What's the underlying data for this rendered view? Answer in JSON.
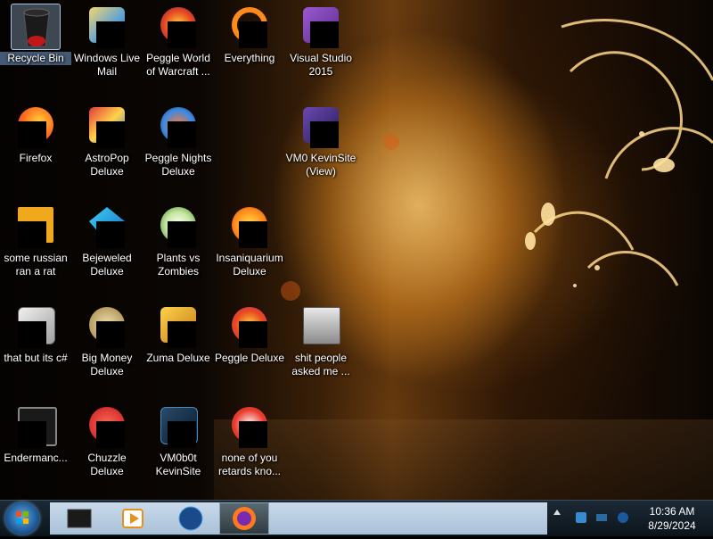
{
  "desktop_icons": [
    {
      "label": "Recycle Bin",
      "icon": "recycle-bin-icon"
    },
    {
      "label": "Windows Live Mail",
      "icon": "windows-live-mail-icon"
    },
    {
      "label": "Peggle World of Warcraft ...",
      "icon": "peggle-wow-icon"
    },
    {
      "label": "Everything",
      "icon": "everything-search-icon"
    },
    {
      "label": "Visual Studio 2015",
      "icon": "visual-studio-icon"
    },
    {
      "label": "Firefox",
      "icon": "firefox-icon"
    },
    {
      "label": "AstroPop Deluxe",
      "icon": "astropop-icon"
    },
    {
      "label": "Peggle Nights Deluxe",
      "icon": "peggle-nights-icon"
    },
    {
      "label": "VM0 KevinSite (View)",
      "icon": "visual-studio-file-icon"
    },
    {
      "label": "some russian ran a rat",
      "icon": "java-file-icon"
    },
    {
      "label": "Bejeweled Deluxe",
      "icon": "bejeweled-icon"
    },
    {
      "label": "Plants vs Zombies",
      "icon": "plants-vs-zombies-icon"
    },
    {
      "label": "Insaniquarium Deluxe",
      "icon": "insaniquarium-icon"
    },
    {
      "label": "that but its c#",
      "icon": "folder-stack-icon"
    },
    {
      "label": "Big Money Deluxe",
      "icon": "big-money-icon"
    },
    {
      "label": "Zuma Deluxe",
      "icon": "zuma-icon"
    },
    {
      "label": "Peggle Deluxe",
      "icon": "peggle-icon"
    },
    {
      "label": "shit people asked me ...",
      "icon": "folder-icon"
    },
    {
      "label": "Endermanc...",
      "icon": "terminal-icon"
    },
    {
      "label": "Chuzzle Deluxe",
      "icon": "chuzzle-icon"
    },
    {
      "label": "VM0b0t KevinSite",
      "icon": "vm-shortcut-icon"
    },
    {
      "label": "none of you retards kno...",
      "icon": "app-icon"
    }
  ],
  "taskbar": {
    "start_icon": "windows-start-icon",
    "pinned": [
      {
        "icon": "recycle-bin-taskbar-icon"
      },
      {
        "icon": "media-player-icon"
      },
      {
        "icon": "globe-icon"
      },
      {
        "icon": "firefox-taskbar-icon",
        "active": true
      }
    ],
    "clock_time": "10:36 AM",
    "clock_date": "8/29/2024"
  },
  "colors": {
    "taskbar": "#0c141b",
    "taskbar_band": "#b9cde0",
    "selection": "#aac8e6",
    "wallpaper_glow": "#f3b456"
  }
}
